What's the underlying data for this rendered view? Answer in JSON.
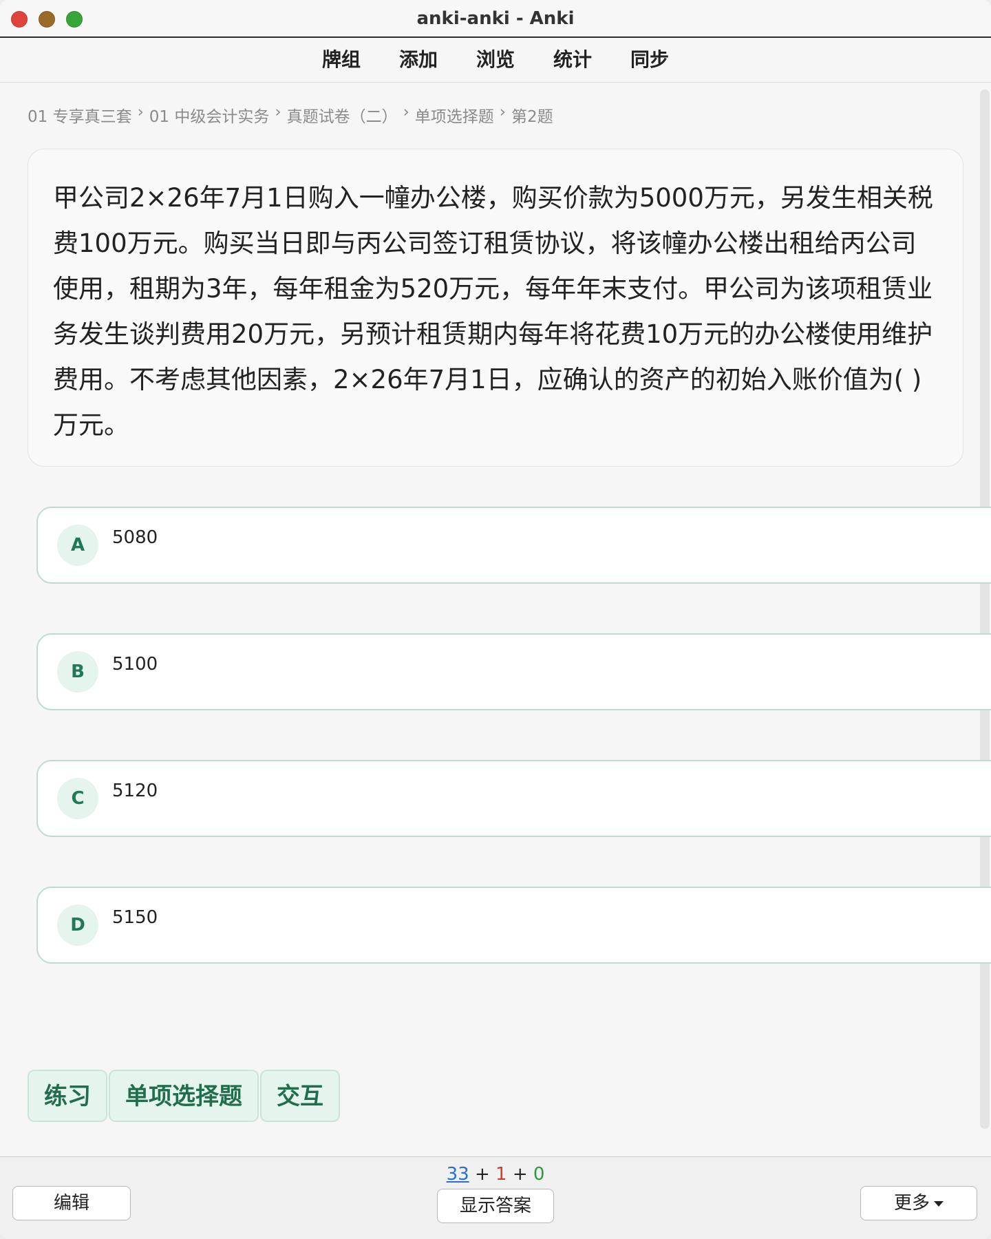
{
  "window": {
    "title": "anki-anki - Anki"
  },
  "toolbar": {
    "items": [
      "牌组",
      "添加",
      "浏览",
      "统计",
      "同步"
    ]
  },
  "breadcrumb": [
    "01 专享真三套",
    "01 中级会计实务",
    "真题试卷（二）",
    "单项选择题",
    "第2题"
  ],
  "question": {
    "text": "甲公司2×26年7月1日购入一幢办公楼，购买价款为5000万元，另发生相关税费100万元。购买当日即与丙公司签订租赁协议，将该幢办公楼出租给丙公司使用，租期为3年，每年租金为520万元，每年年末支付。甲公司为该项租赁业务发生谈判费用20万元，另预计租赁期内每年将花费10万元的办公楼使用维护费用。不考虑其他因素，2×26年7月1日，应确认的资产的初始入账价值为( )万元。"
  },
  "options": [
    {
      "letter": "A",
      "text": "5080"
    },
    {
      "letter": "B",
      "text": "5100"
    },
    {
      "letter": "C",
      "text": "5120"
    },
    {
      "letter": "D",
      "text": "5150"
    }
  ],
  "tags": [
    "练习",
    "单项选择题",
    "交互"
  ],
  "bottom": {
    "edit_label": "编辑",
    "show_answer_label": "显示答案",
    "more_label": "更多",
    "counts": {
      "new": "33",
      "learn": "1",
      "review": "0",
      "sep": "+"
    }
  },
  "colors": {
    "accent": "#1f7a55",
    "option_border": "#bcdcd0",
    "tag_bg": "#e6f4ee",
    "count_new": "#2a6fd8",
    "count_learn": "#d83a2a",
    "count_review": "#2a9a3a"
  }
}
